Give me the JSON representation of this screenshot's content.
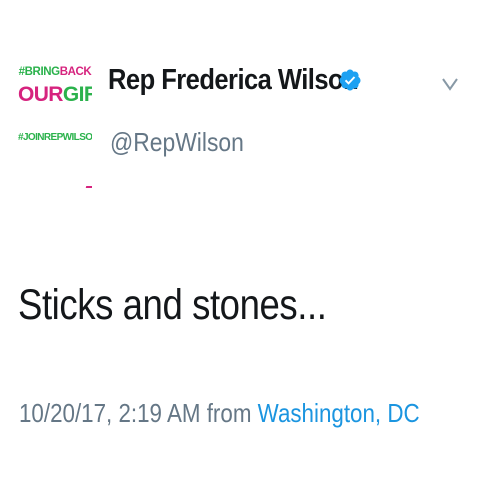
{
  "colors": {
    "text": "#14171a",
    "secondary_text": "#657786",
    "link": "#1b95e0",
    "verified": "#1da1f2",
    "brand_green": "#2bb24c",
    "brand_pink": "#d6237e"
  },
  "author": {
    "display_name": "Rep Frederica Wilson",
    "handle": "@RepWilson",
    "verified_icon": "verified-badge-icon",
    "avatar": {
      "line1_a": "#BRING",
      "line1_b": "BACK",
      "line2_a": "OUR",
      "line2_b": "GIRLS",
      "line3": "#JOINREPWILSON"
    }
  },
  "menu": {
    "icon": "chevron-down-icon"
  },
  "tweet": {
    "text": "Sticks and stones...",
    "timestamp": "10/20/17, 2:19 AM",
    "from_label": "from",
    "location": "Washington, DC"
  }
}
